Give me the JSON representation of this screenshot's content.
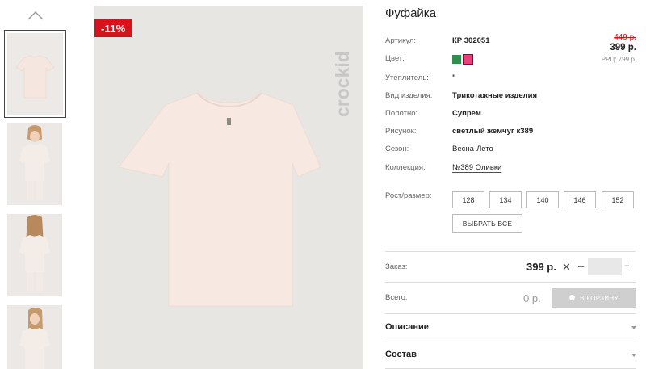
{
  "product": {
    "title": "Фуфайка",
    "discount_badge": "-11%",
    "brand_logo": "crockid"
  },
  "attributes": [
    {
      "label": "Артикул:",
      "value": "КР 302051"
    },
    {
      "label": "Цвет:",
      "value": ""
    },
    {
      "label": "Утеплитель:",
      "value": "\""
    },
    {
      "label": "Вид изделия:",
      "value": "Трикотажные изделия"
    },
    {
      "label": "Полотно:",
      "value": "Супрем"
    },
    {
      "label": "Рисунок:",
      "value": "светлый жемчуг к389"
    },
    {
      "label": "Сезон:",
      "value": "Весна-Лето"
    },
    {
      "label": "Коллекция:",
      "value": "№389 Оливки"
    }
  ],
  "colors": [
    {
      "name": "green",
      "hex": "#2f8d4d",
      "selected": false
    },
    {
      "name": "pink",
      "hex": "#e8417b",
      "selected": true
    }
  ],
  "pricing": {
    "old_price": "449 р.",
    "price": "399 р.",
    "rrp_label": "РРЦ: 799 р."
  },
  "sizes": {
    "label": "Рост/размер:",
    "options": [
      "128",
      "134",
      "140",
      "146",
      "152"
    ],
    "select_all": "ВЫБРАТЬ ВСЕ"
  },
  "order": {
    "label": "Заказ:",
    "price": "399 р.",
    "times": "✕",
    "minus": "–",
    "plus": "+",
    "quantity": ""
  },
  "total": {
    "label": "Всего:",
    "value": "0 р.",
    "cart_button": "В КОРЗИНУ"
  },
  "accordions": [
    {
      "title": "Описание"
    },
    {
      "title": "Состав"
    }
  ],
  "thumbnails": [
    {
      "name": "tshirt-flat",
      "selected": true
    },
    {
      "name": "model-front",
      "selected": false
    },
    {
      "name": "model-back",
      "selected": false
    },
    {
      "name": "model-side",
      "selected": false
    }
  ]
}
